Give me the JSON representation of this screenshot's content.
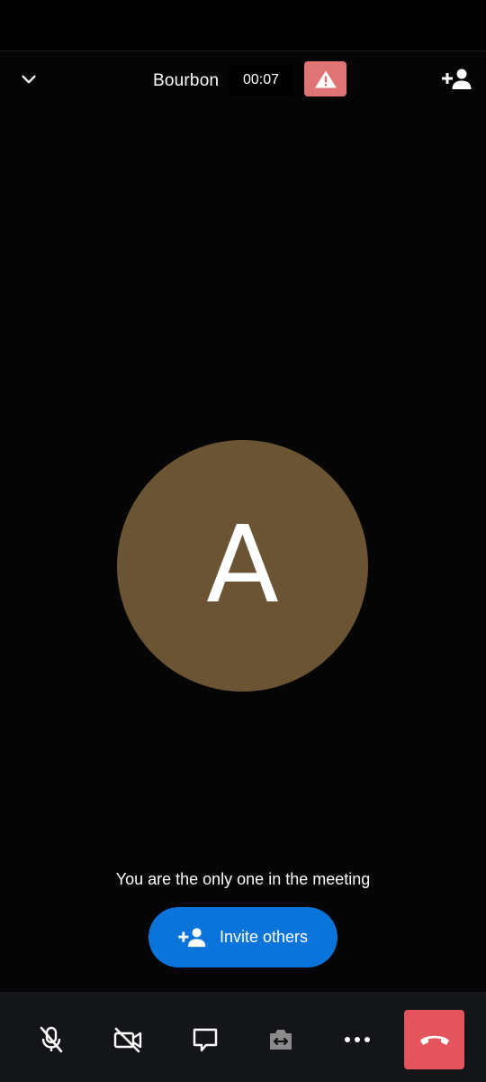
{
  "header": {
    "meeting_name": "Bourbon",
    "timer": "00:07"
  },
  "participant": {
    "initial": "A",
    "avatar_color": "#6b5433"
  },
  "main": {
    "only_one_message": "You are the only one in the meeting",
    "invite_label": "Invite others"
  },
  "colors": {
    "background": "#050505",
    "warning": "#e07373",
    "invite_button": "#0a74da",
    "hangup": "#e3545c",
    "toolbar": "#141518"
  },
  "icons": {
    "collapse": "chevron-down-icon",
    "warning": "warning-icon",
    "add_person": "add-person-icon",
    "mic": "mic-off-icon",
    "camera": "camera-off-icon",
    "chat": "chat-icon",
    "flip": "flip-camera-icon",
    "more": "more-icon",
    "hangup": "hang-up-icon"
  }
}
